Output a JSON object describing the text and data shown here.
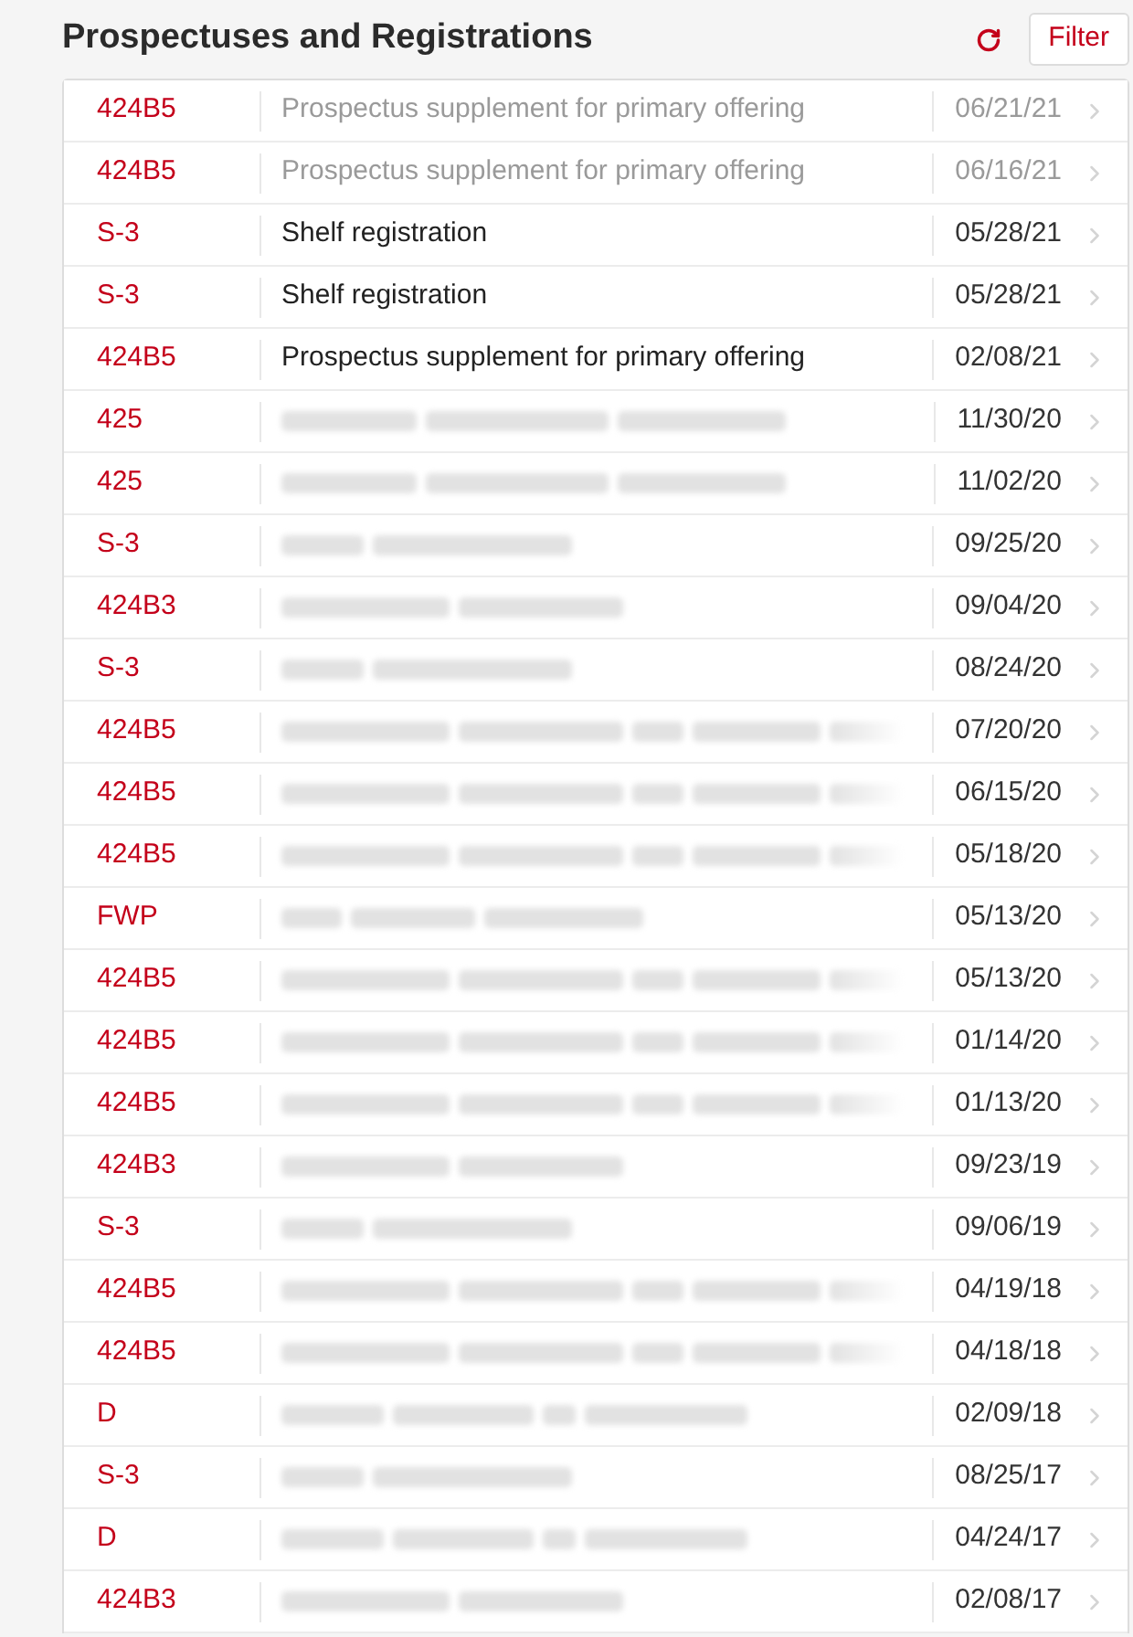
{
  "header": {
    "title": "Prospectuses and Registrations",
    "filter_button": "Filter"
  },
  "rows": [
    {
      "form": "424B5",
      "kind": "text",
      "description": "Prospectus supplement for primary offering",
      "date": "06/21/21",
      "visited": true
    },
    {
      "form": "424B5",
      "kind": "text",
      "description": "Prospectus supplement for primary offering",
      "date": "06/16/21",
      "visited": true
    },
    {
      "form": "S-3",
      "kind": "text",
      "description": "Shelf registration",
      "date": "05/28/21",
      "visited": false
    },
    {
      "form": "S-3",
      "kind": "text",
      "description": "Shelf registration",
      "date": "05/28/21",
      "visited": false
    },
    {
      "form": "424B5",
      "kind": "text",
      "description": "Prospectus supplement for primary offering",
      "date": "02/08/21",
      "visited": false
    },
    {
      "form": "425",
      "kind": "blur-wide",
      "date": "11/30/20",
      "visited": false
    },
    {
      "form": "425",
      "kind": "blur-wide",
      "date": "11/02/20",
      "visited": false
    },
    {
      "form": "S-3",
      "kind": "blur-short",
      "date": "09/25/20",
      "visited": false
    },
    {
      "form": "424B3",
      "kind": "blur-medium",
      "date": "09/04/20",
      "visited": false
    },
    {
      "form": "S-3",
      "kind": "blur-short",
      "date": "08/24/20",
      "visited": false
    },
    {
      "form": "424B5",
      "kind": "blur-long",
      "date": "07/20/20",
      "visited": false
    },
    {
      "form": "424B5",
      "kind": "blur-long",
      "date": "06/15/20",
      "visited": false
    },
    {
      "form": "424B5",
      "kind": "blur-long",
      "date": "05/18/20",
      "visited": false
    },
    {
      "form": "FWP",
      "kind": "blur-compact",
      "date": "05/13/20",
      "visited": false
    },
    {
      "form": "424B5",
      "kind": "blur-long",
      "date": "05/13/20",
      "visited": false
    },
    {
      "form": "424B5",
      "kind": "blur-long",
      "date": "01/14/20",
      "visited": false
    },
    {
      "form": "424B5",
      "kind": "blur-long",
      "date": "01/13/20",
      "visited": false
    },
    {
      "form": "424B3",
      "kind": "blur-medium",
      "date": "09/23/19",
      "visited": false
    },
    {
      "form": "S-3",
      "kind": "blur-short",
      "date": "09/06/19",
      "visited": false
    },
    {
      "form": "424B5",
      "kind": "blur-long",
      "date": "04/19/18",
      "visited": false
    },
    {
      "form": "424B5",
      "kind": "blur-long",
      "date": "04/18/18",
      "visited": false
    },
    {
      "form": "D",
      "kind": "blur-split",
      "date": "02/09/18",
      "visited": false
    },
    {
      "form": "S-3",
      "kind": "blur-short",
      "date": "08/25/17",
      "visited": false
    },
    {
      "form": "D",
      "kind": "blur-split",
      "date": "04/24/17",
      "visited": false
    },
    {
      "form": "424B3",
      "kind": "blur-medium",
      "date": "02/08/17",
      "visited": false
    }
  ]
}
